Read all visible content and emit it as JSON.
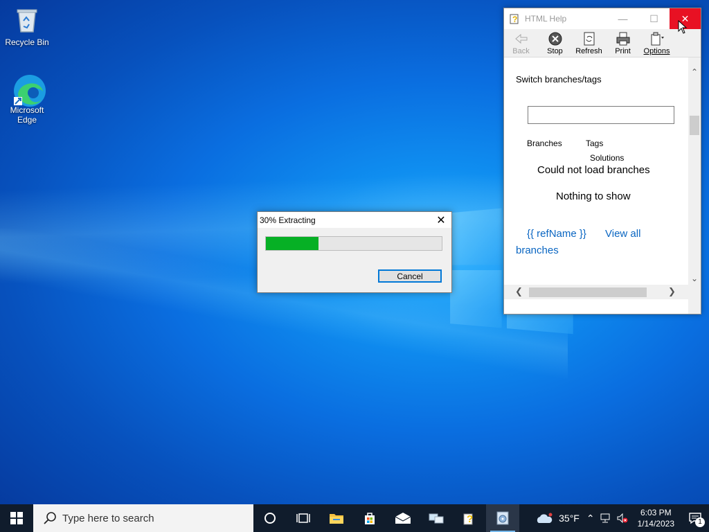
{
  "desktop": {
    "icons": [
      {
        "label": "Recycle Bin"
      },
      {
        "label": "Microsoft Edge"
      }
    ]
  },
  "help_window": {
    "title": "HTML Help",
    "toolbar": {
      "back": "Back",
      "stop": "Stop",
      "refresh": "Refresh",
      "print": "Print",
      "options": "Options"
    },
    "content": {
      "heading": "Switch branches/tags",
      "tab_branches": "Branches",
      "tab_tags": "Tags",
      "solutions": "Solutions",
      "error": "Could not load branches",
      "empty": "Nothing to show",
      "ref_name": "{{ refName }}",
      "view_all": "View all",
      "branches": "branches"
    }
  },
  "extract_dialog": {
    "title": "30% Extracting",
    "progress": 0.3,
    "cancel_label": "Cancel",
    "progress_color": "#06b025"
  },
  "taskbar": {
    "search_placeholder": "Type here to search",
    "weather": "35°F",
    "time": "6:03 PM",
    "date": "1/14/2023",
    "notification_count": "1"
  }
}
